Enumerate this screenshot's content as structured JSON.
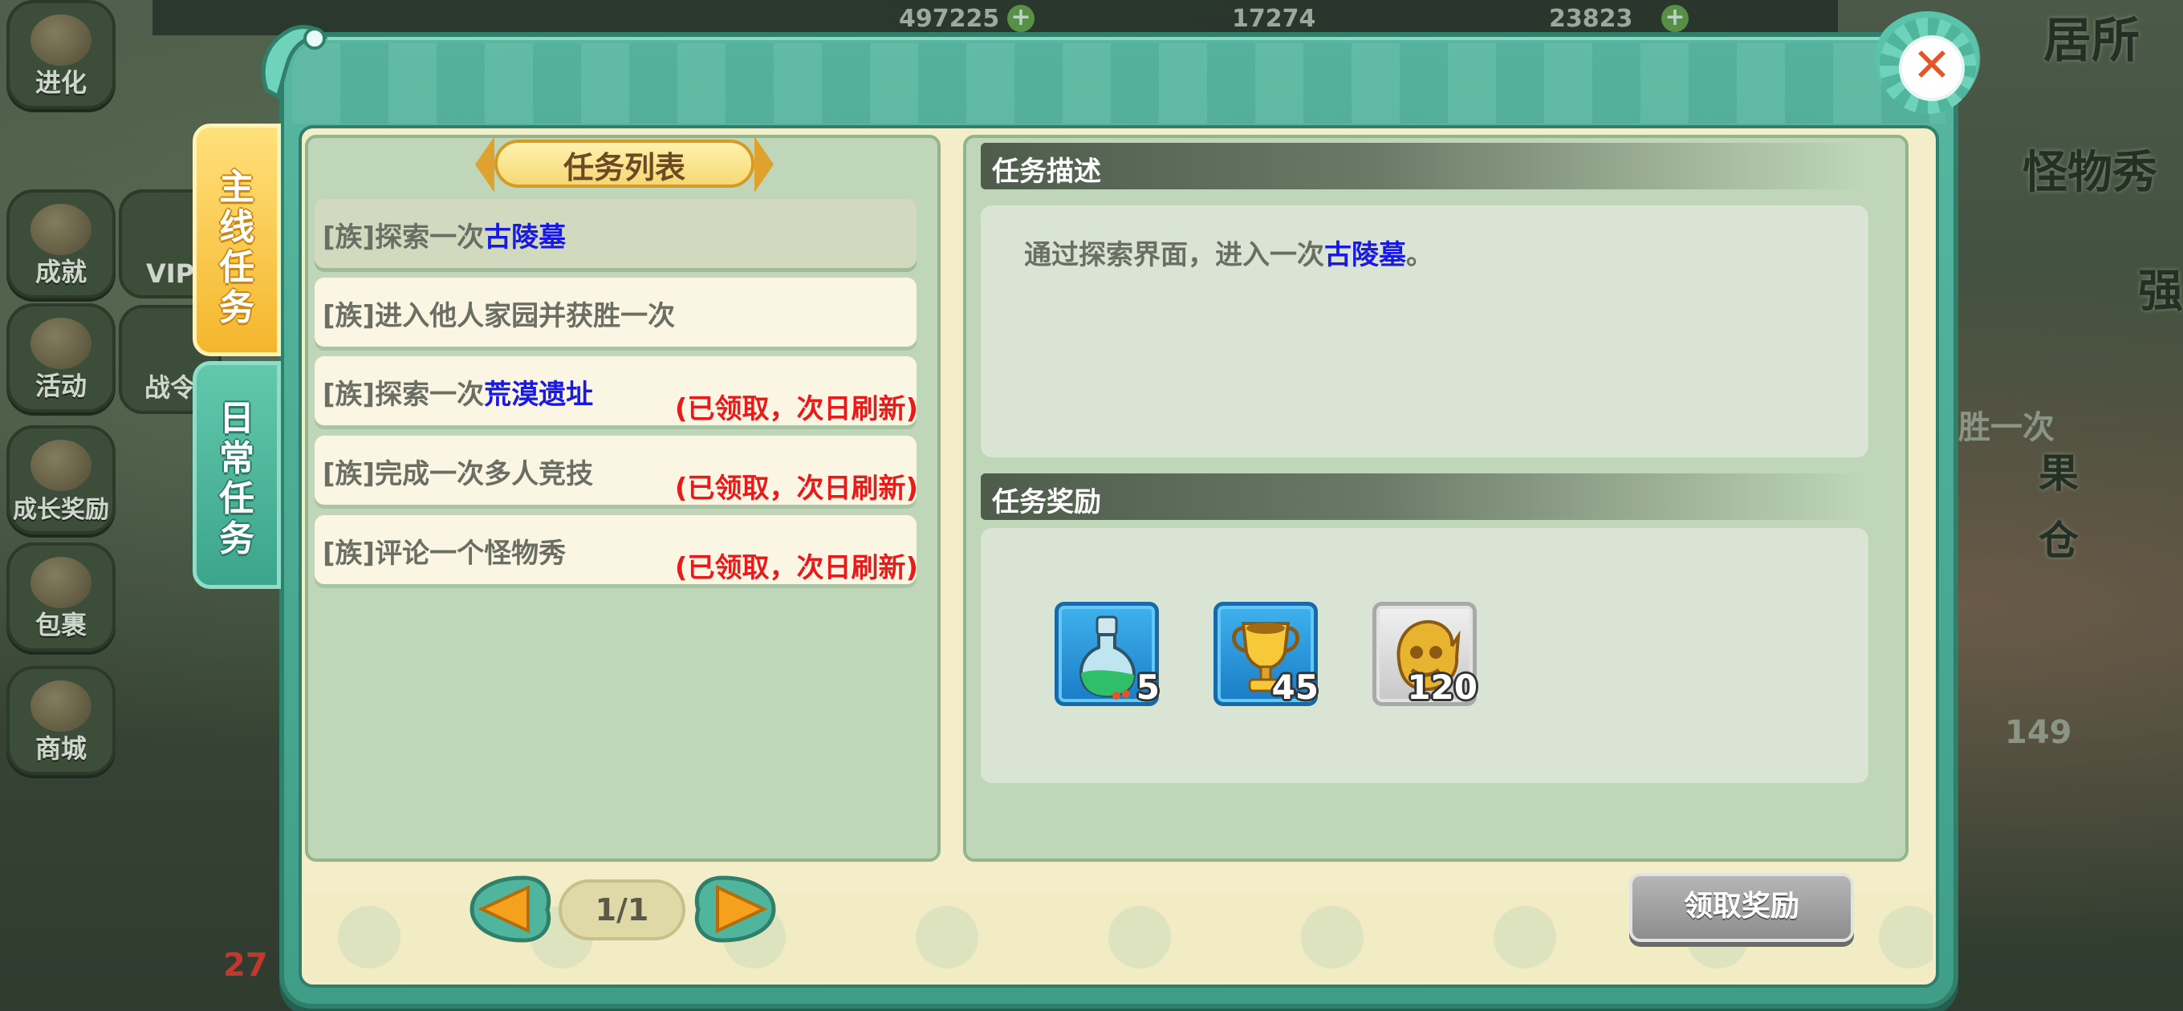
{
  "background": {
    "top_stats": [
      "497225",
      "17274",
      "23823"
    ],
    "side_buttons": [
      "进化",
      "成就",
      "活动",
      "成长奖励",
      "包裹",
      "商城"
    ],
    "side_buttons_2": [
      "VIP",
      "战令"
    ],
    "right_labels": [
      "居所",
      "怪物秀",
      "强",
      "胜一次",
      "果",
      "仓",
      "149"
    ],
    "wifi_number": "27"
  },
  "tabs": [
    {
      "label": "主线任务",
      "active": true
    },
    {
      "label": "日常任务",
      "active": false
    }
  ],
  "task_list": {
    "title": "任务列表",
    "tasks": [
      {
        "prefix": "[族]探索一次",
        "highlight": "古陵墓",
        "suffix": "",
        "status": "",
        "selected": true
      },
      {
        "prefix": "[族]进入他人家园并获胜一次",
        "highlight": "",
        "suffix": "",
        "status": "",
        "selected": false
      },
      {
        "prefix": "[族]探索一次",
        "highlight": "荒漠遗址",
        "suffix": "",
        "status": "(已领取，次日刷新)",
        "selected": false
      },
      {
        "prefix": "[族]完成一次多人竞技",
        "highlight": "",
        "suffix": "",
        "status": "(已领取，次日刷新)",
        "selected": false
      },
      {
        "prefix": "[族]评论一个怪物秀",
        "highlight": "",
        "suffix": "",
        "status": "(已领取，次日刷新)",
        "selected": false
      }
    ]
  },
  "detail": {
    "description_header": "任务描述",
    "description_prefix": "通过探索界面，进入一次",
    "description_highlight": "古陵墓",
    "description_suffix": "。",
    "reward_header": "任务奖励",
    "rewards": [
      {
        "icon": "potion-icon",
        "count": "5"
      },
      {
        "icon": "trophy-icon",
        "count": "45"
      },
      {
        "icon": "gold-emblem-icon",
        "count": "120"
      }
    ]
  },
  "pagination": {
    "label": "1/1"
  },
  "claim_button": {
    "label": "领取奖励"
  },
  "colors": {
    "highlight": "#1919e6",
    "status": "#e81a1a",
    "frame": "#4fae96",
    "tab_active": "#f5b62c"
  }
}
